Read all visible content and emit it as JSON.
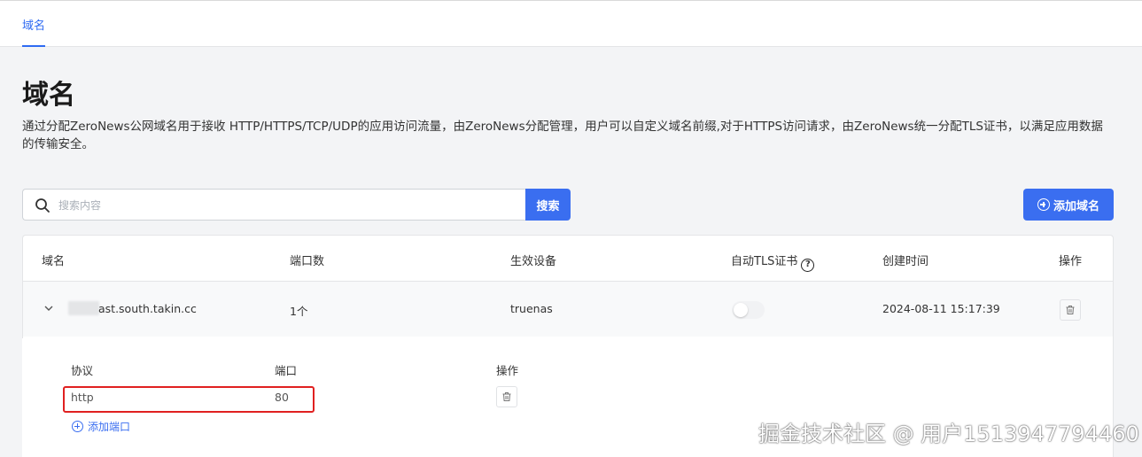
{
  "nav": {
    "tab_label": "域名"
  },
  "page": {
    "title": "域名",
    "description": "通过分配ZeroNews公网域名用于接收 HTTP/HTTPS/TCP/UDP的应用访问流量，由ZeroNews分配管理，用户可以自定义域名前缀,对于HTTPS访问请求，由ZeroNews统一分配TLS证书，以满足应用数据的传输安全。"
  },
  "search": {
    "placeholder": "搜索内容",
    "value": "",
    "button_label": "搜索"
  },
  "actions": {
    "add_domain_label": "添加域名"
  },
  "table": {
    "headers": {
      "domain": "域名",
      "port_count": "端口数",
      "device": "生效设备",
      "auto_tls": "自动TLS证书",
      "auto_tls_help": "?",
      "created": "创建时间",
      "actions": "操作"
    },
    "rows": [
      {
        "domain": "ast.south.takin.cc",
        "port_count": "1个",
        "device": "truenas",
        "auto_tls_enabled": false,
        "created": "2024-08-11 15:17:39"
      }
    ]
  },
  "ports": {
    "headers": {
      "protocol": "协议",
      "port": "端口",
      "actions": "操作"
    },
    "rows": [
      {
        "protocol": "http",
        "port": "80"
      }
    ],
    "add_label": "添加端口"
  },
  "watermark": "掘金技术社区 @ 用户1513947794460",
  "colors": {
    "accent": "#3a6ef0",
    "highlight": "#e02020"
  },
  "icons": [
    "search-icon",
    "plus-circle-icon",
    "help-icon",
    "chevron-down-icon",
    "trash-icon"
  ]
}
